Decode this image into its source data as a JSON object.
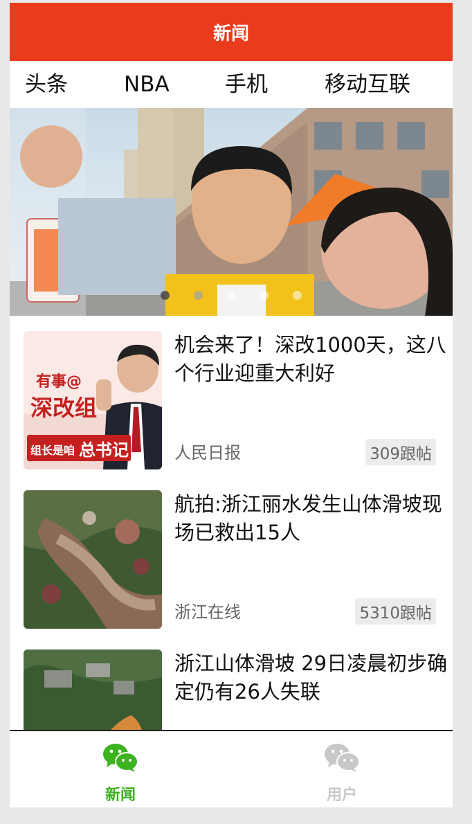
{
  "header": {
    "title": "新闻"
  },
  "tabs": [
    {
      "label": "头条"
    },
    {
      "label": "NBA"
    },
    {
      "label": "手机"
    },
    {
      "label": "移动互联"
    }
  ],
  "banner": {
    "slide_count": 5,
    "active_index": 0
  },
  "news": [
    {
      "title": "机会来了！深改1000天，这八个行业迎重大利好",
      "source": "人民日报",
      "replies": "309跟帖",
      "thumb_text": {
        "line1": "有事@",
        "line2": "深改组",
        "line3": "组长是咱",
        "line4": "总书记"
      }
    },
    {
      "title": "航拍:浙江丽水发生山体滑坡现场已救出15人",
      "source": "浙江在线",
      "replies": "5310跟帖"
    },
    {
      "title": "浙江山体滑坡 29日凌晨初步确定仍有26人失联",
      "source": "",
      "replies": ""
    }
  ],
  "bottom_bar": [
    {
      "label": "新闻",
      "active": true,
      "icon": "wechat-icon"
    },
    {
      "label": "用户",
      "active": false,
      "icon": "wechat-icon"
    }
  ],
  "colors": {
    "brand": "#ea3b1c",
    "active_tab": "#3cb31f",
    "inactive_tab": "#c8c8c8"
  }
}
